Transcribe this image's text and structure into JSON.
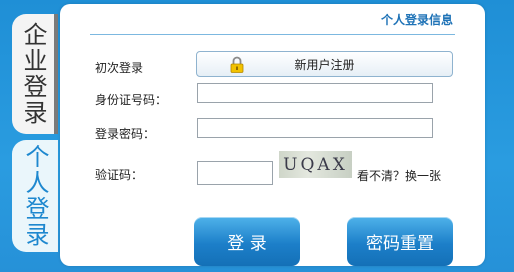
{
  "tabs": {
    "company": "企业登录",
    "personal": "个人登录"
  },
  "panel_title": "个人登录信息",
  "form": {
    "first_login_label": "初次登录",
    "register_button": "新用户注册",
    "id_label": "身份证号码：",
    "id_value": "",
    "password_label": "登录密码：",
    "password_value": "",
    "captcha_label": "验证码：",
    "captcha_value": "",
    "captcha_text": "UQAX",
    "refresh_text": "看不清？换一张"
  },
  "buttons": {
    "login": "登 录",
    "reset": "密码重置"
  }
}
